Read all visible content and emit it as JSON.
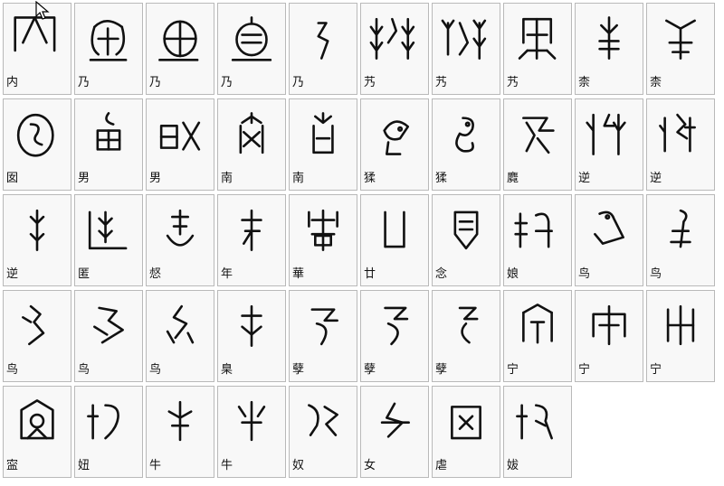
{
  "cells": [
    {
      "label": "内",
      "icon": "oracle-bone-glyph-nei"
    },
    {
      "label": "乃",
      "icon": "oracle-bone-glyph-nai-1"
    },
    {
      "label": "乃",
      "icon": "oracle-bone-glyph-nai-2"
    },
    {
      "label": "乃",
      "icon": "oracle-bone-glyph-nai-3"
    },
    {
      "label": "乃",
      "icon": "oracle-bone-glyph-nai-4"
    },
    {
      "label": "艿",
      "icon": "oracle-bone-glyph-reng-1"
    },
    {
      "label": "艿",
      "icon": "oracle-bone-glyph-reng-2"
    },
    {
      "label": "艿",
      "icon": "oracle-bone-glyph-reng-3"
    },
    {
      "label": "柰",
      "icon": "oracle-bone-glyph-nai-tree-1"
    },
    {
      "label": "柰",
      "icon": "oracle-bone-glyph-nai-tree-2"
    },
    {
      "label": "囡",
      "icon": "oracle-bone-glyph-nan-girl"
    },
    {
      "label": "男",
      "icon": "oracle-bone-glyph-nan-man-1"
    },
    {
      "label": "男",
      "icon": "oracle-bone-glyph-nan-man-2"
    },
    {
      "label": "南",
      "icon": "oracle-bone-glyph-nan-south-1"
    },
    {
      "label": "南",
      "icon": "oracle-bone-glyph-nan-south-2"
    },
    {
      "label": "猱",
      "icon": "oracle-bone-glyph-nao-1"
    },
    {
      "label": "猱",
      "icon": "oracle-bone-glyph-nao-2"
    },
    {
      "label": "麑",
      "icon": "oracle-bone-glyph-ni-deer"
    },
    {
      "label": "逆",
      "icon": "oracle-bone-glyph-ni-1"
    },
    {
      "label": "逆",
      "icon": "oracle-bone-glyph-ni-2"
    },
    {
      "label": "逆",
      "icon": "oracle-bone-glyph-ni-3"
    },
    {
      "label": "匿",
      "icon": "oracle-bone-glyph-ni-hide"
    },
    {
      "label": "惄",
      "icon": "oracle-bone-glyph-ni-heart"
    },
    {
      "label": "年",
      "icon": "oracle-bone-glyph-nian-year"
    },
    {
      "label": "華",
      "icon": "oracle-bone-glyph-hua"
    },
    {
      "label": "廿",
      "icon": "oracle-bone-glyph-nian-twenty"
    },
    {
      "label": "念",
      "icon": "oracle-bone-glyph-nian-think"
    },
    {
      "label": "娘",
      "icon": "oracle-bone-glyph-niang"
    },
    {
      "label": "鸟",
      "icon": "oracle-bone-glyph-niao-1"
    },
    {
      "label": "鸟",
      "icon": "oracle-bone-glyph-niao-2"
    },
    {
      "label": "鸟",
      "icon": "oracle-bone-glyph-niao-3"
    },
    {
      "label": "鸟",
      "icon": "oracle-bone-glyph-niao-4"
    },
    {
      "label": "鸟",
      "icon": "oracle-bone-glyph-niao-5"
    },
    {
      "label": "臬",
      "icon": "oracle-bone-glyph-nie"
    },
    {
      "label": "孽",
      "icon": "oracle-bone-glyph-nie-sin-1"
    },
    {
      "label": "孽",
      "icon": "oracle-bone-glyph-nie-sin-2"
    },
    {
      "label": "孽",
      "icon": "oracle-bone-glyph-nie-sin-3"
    },
    {
      "label": "宁",
      "icon": "oracle-bone-glyph-ning-1"
    },
    {
      "label": "宁",
      "icon": "oracle-bone-glyph-ning-2"
    },
    {
      "label": "宁",
      "icon": "oracle-bone-glyph-ning-3"
    },
    {
      "label": "寍",
      "icon": "oracle-bone-glyph-ning-4"
    },
    {
      "label": "妞",
      "icon": "oracle-bone-glyph-niu-girl"
    },
    {
      "label": "牛",
      "icon": "oracle-bone-glyph-niu-ox-1"
    },
    {
      "label": "牛",
      "icon": "oracle-bone-glyph-niu-ox-2"
    },
    {
      "label": "奴",
      "icon": "oracle-bone-glyph-nu-slave"
    },
    {
      "label": "女",
      "icon": "oracle-bone-glyph-nu-woman"
    },
    {
      "label": "虐",
      "icon": "oracle-bone-glyph-nue"
    },
    {
      "label": "妭",
      "icon": "oracle-bone-glyph-ba"
    },
    {
      "label": "",
      "icon": ""
    },
    {
      "label": "",
      "icon": ""
    }
  ]
}
